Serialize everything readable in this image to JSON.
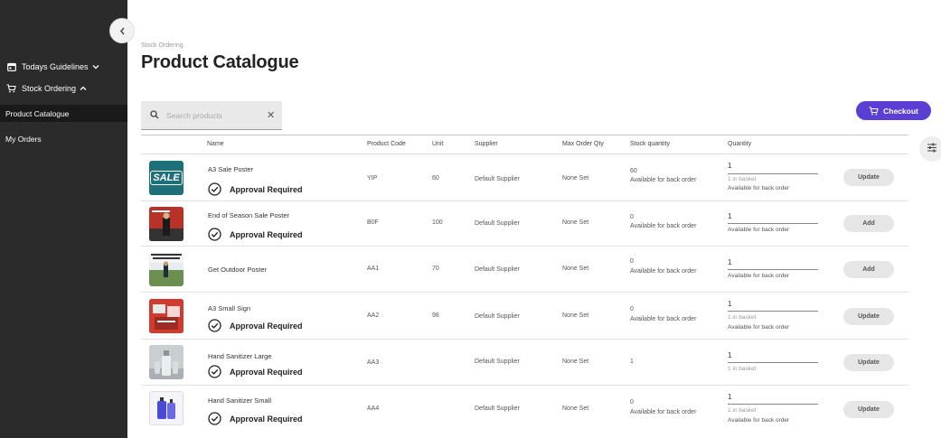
{
  "sidebar": {
    "collapse_icon": "chevron-left-icon",
    "items": [
      {
        "label": "Todays Guidelines",
        "icon": "calendar-icon"
      },
      {
        "label": "Stock Ordering",
        "icon": "cart-icon"
      },
      {
        "label": "Product Catalogue"
      },
      {
        "label": "My Orders"
      }
    ]
  },
  "header": {
    "breadcrumb": "Stock Ordering",
    "title": "Product Catalogue"
  },
  "search": {
    "placeholder": "Search products",
    "value": ""
  },
  "checkout": {
    "label": "Checkout",
    "color": "#5b3fd4"
  },
  "table": {
    "columns": [
      "Name",
      "Product Code",
      "Unit",
      "Supplier",
      "Max Order Qty",
      "Stock quantity",
      "Quantity"
    ],
    "rows": [
      {
        "name": "A3 Sale Poster",
        "approval": "Approval Required",
        "code": "YIP",
        "unit": "60",
        "supplier": "Default Supplier",
        "max_qty": "None Set",
        "stock": "60",
        "stock_note": "Available for back order",
        "quantity": "1",
        "basket": "1 in basket",
        "back_order": "Available for back order",
        "action": "Update"
      },
      {
        "name": "End of Season Sale Poster",
        "approval": "Approval Required",
        "code": "B0F",
        "unit": "100",
        "supplier": "Default Supplier",
        "max_qty": "None Set",
        "stock": "0",
        "stock_note": "Available for back order",
        "quantity": "1",
        "basket": "",
        "back_order": "Available for back order",
        "action": "Add"
      },
      {
        "name": "Get Outdoor Poster",
        "approval": "",
        "code": "AA1",
        "unit": "70",
        "supplier": "Default Supplier",
        "max_qty": "None Set",
        "stock": "0",
        "stock_note": "Available for back order",
        "quantity": "1",
        "basket": "",
        "back_order": "Available for back order",
        "action": "Add"
      },
      {
        "name": "A3 Small Sign",
        "approval": "Approval Required",
        "code": "AA2",
        "unit": "98",
        "supplier": "Default Supplier",
        "max_qty": "None Set",
        "stock": "0",
        "stock_note": "Available for back order",
        "quantity": "1",
        "basket": "1 in basket",
        "back_order": "Available for back order",
        "action": "Update"
      },
      {
        "name": "Hand Sanitizer Large",
        "approval": "Approval Required",
        "code": "AA3",
        "unit": "",
        "supplier": "Default Supplier",
        "max_qty": "None Set",
        "stock": "1",
        "stock_note": "",
        "quantity": "1",
        "basket": "1 in basket",
        "back_order": "",
        "action": "Update"
      },
      {
        "name": "Hand Sanitizer Small",
        "approval": "Approval Required",
        "code": "AA4",
        "unit": "",
        "supplier": "Default Supplier",
        "max_qty": "None Set",
        "stock": "0",
        "stock_note": "Available for back order",
        "quantity": "1",
        "basket": "1 in basket",
        "back_order": "Available for back order",
        "action": "Update"
      }
    ]
  },
  "thumbs": {
    "sale_poster": "SALE"
  }
}
